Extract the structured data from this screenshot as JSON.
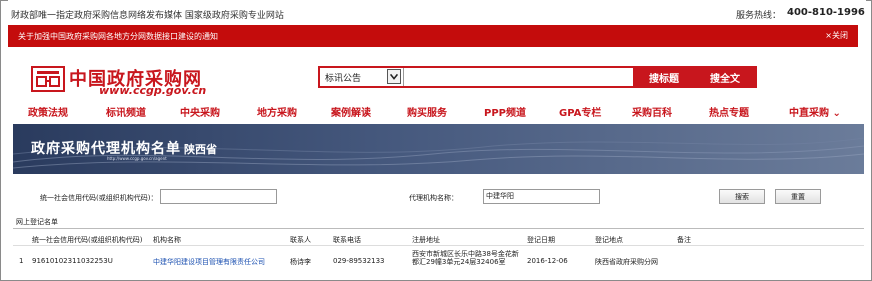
{
  "topbar": {
    "slogan": "财政部唯一指定政府采购信息网络发布媒体  国家级政府采购专业网站",
    "hotline_label": "服务热线：",
    "hotline": "400-810-1996"
  },
  "notice": {
    "text": "关于加强中国政府采购网各地方分网数据接口建设的通知",
    "close": "×关闭"
  },
  "logo": {
    "title": "中国政府采购网",
    "url": "www.ccgp.gov.cn"
  },
  "search": {
    "type_selected": "标讯公告",
    "search_title_button": "搜标题",
    "search_full_button": "搜全文"
  },
  "nav": {
    "items": [
      "政策法规",
      "标讯频道",
      "中央采购",
      "地方采购",
      "案例解读",
      "购买服务",
      "PPP频道",
      "GPA专栏",
      "采购百科",
      "热点专题",
      "中直采购"
    ]
  },
  "banner": {
    "title": "政府采购代理机构名单",
    "province": "陕西省",
    "url_small": "http://www.ccgp.gov.cn/agent"
  },
  "filter": {
    "credit_label": "统一社会信用代码(或组织机构代码)：",
    "name_label": "代理机构名称：",
    "name_value": "中建华阳",
    "search_button": "搜索",
    "reset_button": "重置"
  },
  "table": {
    "caption": "网上登记名单",
    "columns": [
      "统一社会信用代码(或组织机构代码)",
      "机构名称",
      "联系人",
      "联系电话",
      "注册地址",
      "登记日期",
      "登记地点",
      "备注"
    ],
    "rows": [
      {
        "index": "1",
        "credit_code": "91610102311032253U",
        "name": "中建华阳建设项目管理有限责任公司",
        "contact": "杨诗李",
        "phone": "029-89532133",
        "address": "西安市新城区长乐中路38号金花新都汇29幢3单元24层32406室",
        "date": "2016-12-06",
        "place": "陕西省政府采购分网",
        "remark": ""
      }
    ]
  },
  "colors": {
    "brand_red": "#c8161d",
    "notice_red": "#c40c0c",
    "banner_navy": "#2a3b5e",
    "link_blue": "#1a4fb0"
  }
}
